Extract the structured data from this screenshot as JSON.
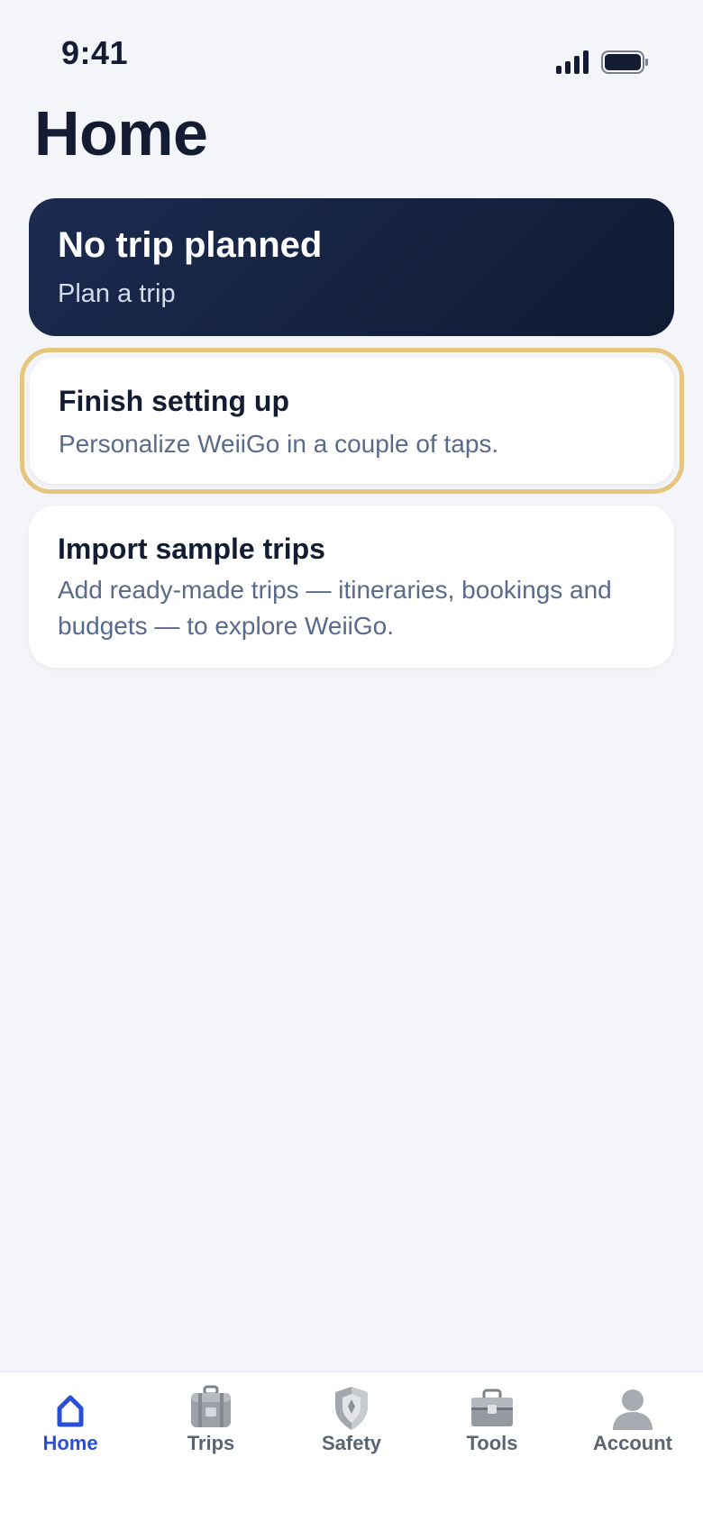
{
  "status_bar": {
    "time": "9:41"
  },
  "header": {
    "title": "Home"
  },
  "hero_card": {
    "title": "No trip planned",
    "subtitle": "Plan a trip"
  },
  "setup_card": {
    "title": "Finish setting up",
    "subtitle": "Personalize WeiiGo in a couple of taps."
  },
  "import_card": {
    "title": "Import sample trips",
    "subtitle": "Add ready-made trips — itineraries, bookings and budgets — to explore WeiiGo."
  },
  "tab_bar": {
    "active": "Home",
    "tabs": [
      {
        "label": "Home",
        "icon": "home-icon"
      },
      {
        "label": "Trips",
        "icon": "luggage-icon"
      },
      {
        "label": "Safety",
        "icon": "shield-icon"
      },
      {
        "label": "Tools",
        "icon": "toolbox-icon"
      },
      {
        "label": "Account",
        "icon": "user-icon"
      }
    ]
  },
  "colors": {
    "background": "#f4f5f9",
    "hero_dark": "#101a33",
    "accent_highlight": "#e6c57e",
    "active_tab": "#2a4fd6",
    "text_primary": "#131c33",
    "text_secondary": "#5a6a8c"
  }
}
